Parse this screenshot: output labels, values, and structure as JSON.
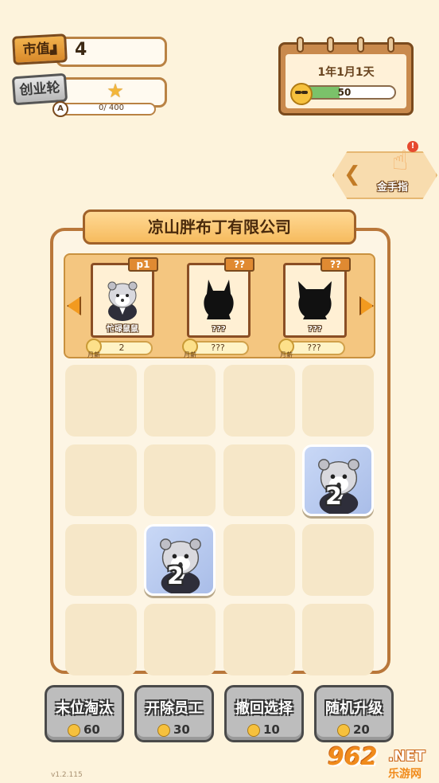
{
  "stats": {
    "market_value_label": "市值",
    "market_value": "4",
    "startup_round_label": "创业轮",
    "rank_letter": "A",
    "xp_text": "0/ 400"
  },
  "calendar": {
    "date": "1年1月1天",
    "mood_value": "50",
    "mood_fraction": 0.45
  },
  "cheat": {
    "label": "金手指",
    "alert": "!"
  },
  "company": {
    "name": "凉山胖布丁有限公司"
  },
  "roster": [
    {
      "tag": "p1",
      "name": "忙碌鼠鼠",
      "salary": "2",
      "salary_label": "月薪"
    },
    {
      "tag": "??",
      "name": "???",
      "salary": "???",
      "salary_label": "月薪"
    },
    {
      "tag": "??",
      "name": "???",
      "salary": "???",
      "salary_label": "月薪"
    }
  ],
  "tiles": [
    {
      "level": "2"
    },
    {
      "level": "2"
    }
  ],
  "actions": [
    {
      "label": "末位淘汰",
      "cost": "60"
    },
    {
      "label": "开除员工",
      "cost": "30"
    },
    {
      "label": "撤回选择",
      "cost": "10"
    },
    {
      "label": "随机升级",
      "cost": "20"
    }
  ],
  "version": "v1.2.115",
  "watermark": {
    "main": "962",
    "sub": ".NET",
    "small": "乐游网"
  },
  "colors": {
    "background": "#fdf3dc",
    "frame": "#b9773a",
    "mood_fill": "#7bc26a",
    "tile": "#a9bde8",
    "button": "#bdbdbd"
  }
}
